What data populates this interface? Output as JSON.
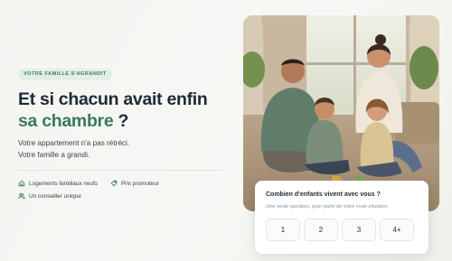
{
  "hero": {
    "eyebrow": "VOTRE FAMILLE S'AGRANDIT",
    "title_line1": "Et si chacun avait enfin",
    "title_accent": "sa chambre",
    "title_suffix": " ?",
    "subtitle_line1": "Votre appartement n'a pas rétréci.",
    "subtitle_line2": "Votre famille a grandi."
  },
  "features": [
    {
      "icon": "house-icon",
      "label": "Logements familiaux neufs"
    },
    {
      "icon": "tag-icon",
      "label": "Prix promoteur"
    },
    {
      "icon": "users-icon",
      "label": "Un conseiller unique"
    }
  ],
  "question_card": {
    "question": "Combien d'enfants vivent avec vous ?",
    "hint": "Une seule question, pour partir de votre vraie situation.",
    "options": [
      "1",
      "2",
      "3",
      "4+"
    ]
  },
  "photo": {
    "subject": "family-on-floor-photo"
  },
  "colors": {
    "accent": "#3b7a56",
    "eyebrow_bg": "#e3efe5",
    "heading": "#1e2a35",
    "background": "#f5f6f2"
  }
}
